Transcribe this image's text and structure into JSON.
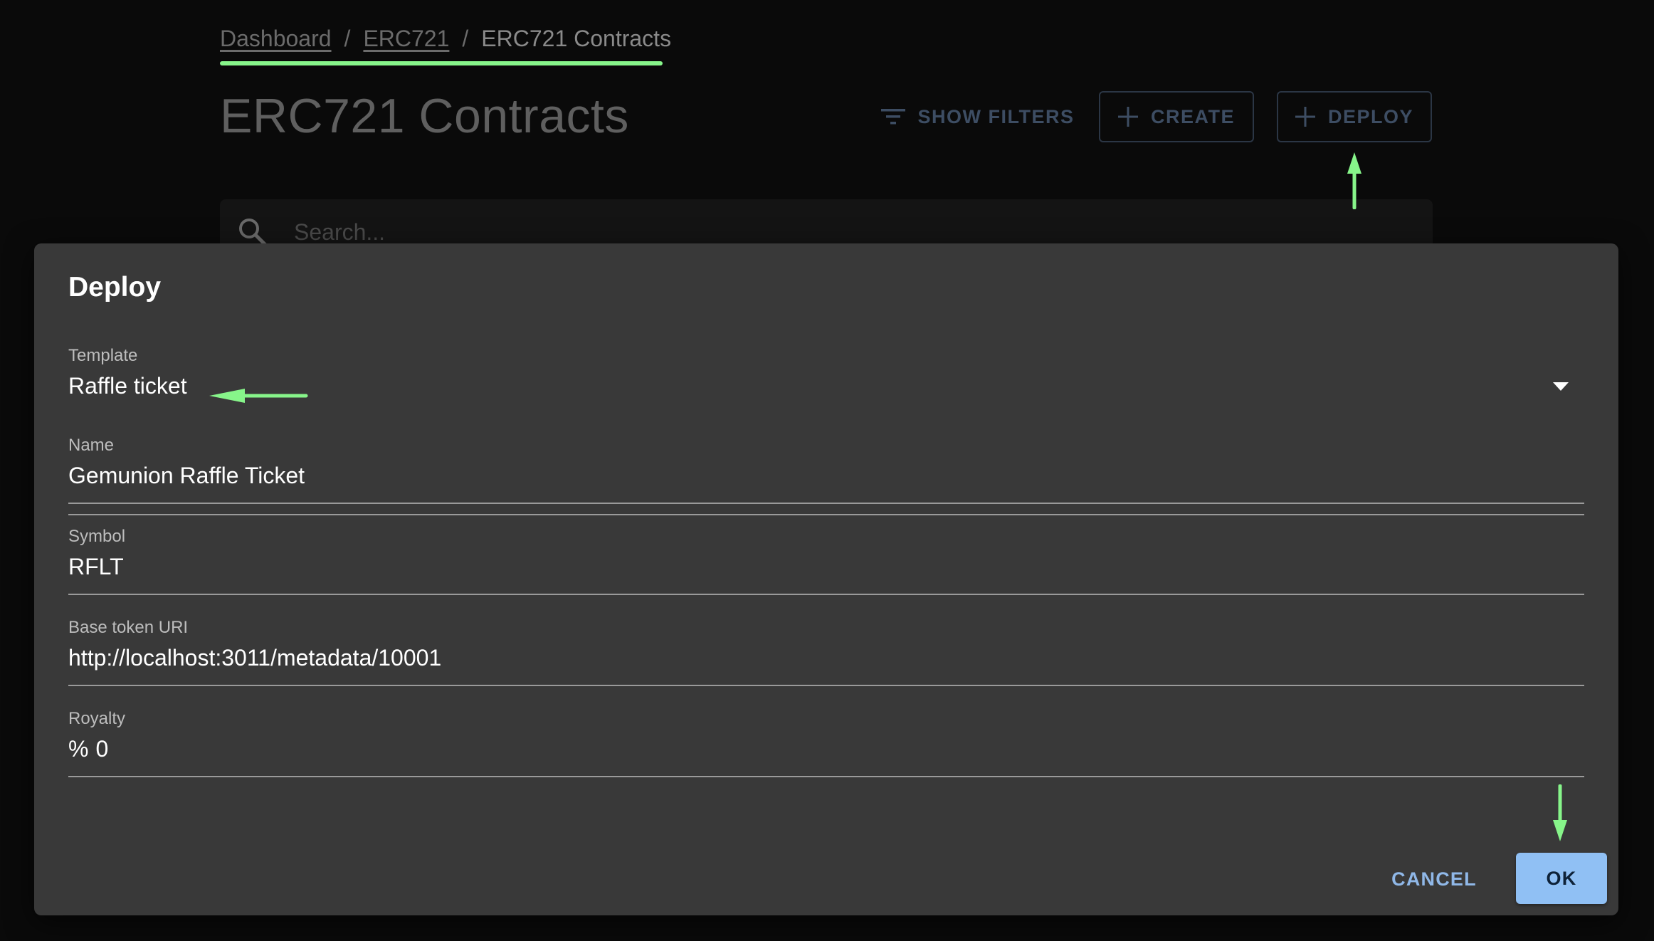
{
  "breadcrumb": {
    "items": [
      {
        "label": "Dashboard"
      },
      {
        "label": "ERC721"
      },
      {
        "label": "ERC721 Contracts"
      }
    ],
    "separator": "/"
  },
  "page": {
    "title": "ERC721 Contracts"
  },
  "toolbar": {
    "show_filters_label": "SHOW FILTERS",
    "create_label": "CREATE",
    "deploy_label": "DEPLOY"
  },
  "search": {
    "placeholder": "Search..."
  },
  "dialog": {
    "title": "Deploy",
    "fields": {
      "template": {
        "label": "Template",
        "value": "Raffle ticket"
      },
      "name": {
        "label": "Name",
        "value": "Gemunion Raffle Ticket"
      },
      "symbol": {
        "label": "Symbol",
        "value": "RFLT"
      },
      "base_token_uri": {
        "label": "Base token URI",
        "value": "http://localhost:3011/metadata/10001"
      },
      "royalty": {
        "label": "Royalty",
        "prefix": "%",
        "value": "0"
      }
    },
    "cancel_label": "CANCEL",
    "ok_label": "OK"
  },
  "colors": {
    "accent_green": "#87f58a",
    "primary_blue": "#90c0f4",
    "dialog_bg": "#393939",
    "page_bg": "#0a0a0a"
  },
  "icons": [
    "filter-icon",
    "plus-icon",
    "search-icon",
    "dropdown-arrow-icon"
  ]
}
